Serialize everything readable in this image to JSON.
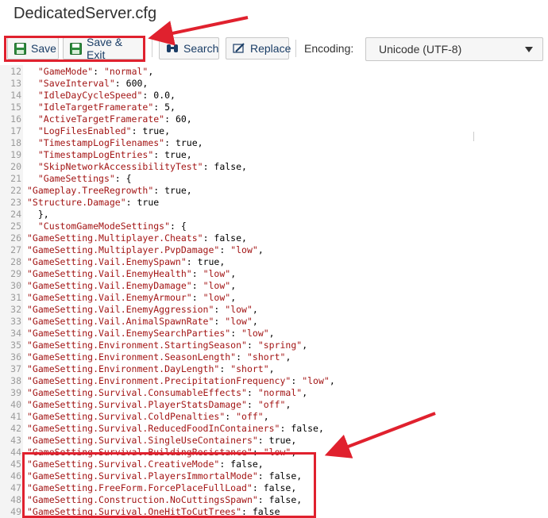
{
  "window": {
    "title": "DedicatedServer.cfg"
  },
  "toolbar": {
    "save_label": "Save",
    "save_exit_label": "Save & Exit",
    "search_label": "Search",
    "replace_label": "Replace",
    "encoding_label": "Encoding:",
    "encoding_value": "Unicode (UTF-8)"
  },
  "colors": {
    "annotation": "#e0212e",
    "string": "#a31515",
    "accent": "#1a3d66"
  },
  "editor": {
    "lines": [
      {
        "n": "12",
        "pre": "  ",
        "key": "\"GameMode\"",
        "post": ": ",
        "val": "\"normal\"",
        "end": ","
      },
      {
        "n": "13",
        "pre": "  ",
        "key": "\"SaveInterval\"",
        "post": ": 600,",
        "val": "",
        "end": ""
      },
      {
        "n": "14",
        "pre": "  ",
        "key": "\"IdleDayCycleSpeed\"",
        "post": ": 0.0,",
        "val": "",
        "end": ""
      },
      {
        "n": "15",
        "pre": "  ",
        "key": "\"IdleTargetFramerate\"",
        "post": ": 5,",
        "val": "",
        "end": ""
      },
      {
        "n": "16",
        "pre": "  ",
        "key": "\"ActiveTargetFramerate\"",
        "post": ": 60,",
        "val": "",
        "end": ""
      },
      {
        "n": "17",
        "pre": "  ",
        "key": "\"LogFilesEnabled\"",
        "post": ": true,",
        "val": "",
        "end": ""
      },
      {
        "n": "18",
        "pre": "  ",
        "key": "\"TimestampLogFilenames\"",
        "post": ": true,",
        "val": "",
        "end": ""
      },
      {
        "n": "19",
        "pre": "  ",
        "key": "\"TimestampLogEntries\"",
        "post": ": true,",
        "val": "",
        "end": ""
      },
      {
        "n": "20",
        "pre": "  ",
        "key": "\"SkipNetworkAccessibilityTest\"",
        "post": ": false,",
        "val": "",
        "end": ""
      },
      {
        "n": "21",
        "pre": "  ",
        "key": "\"GameSettings\"",
        "post": ": {",
        "val": "",
        "end": ""
      },
      {
        "n": "22",
        "pre": "",
        "key": "\"Gameplay.TreeRegrowth\"",
        "post": ": true,",
        "val": "",
        "end": ""
      },
      {
        "n": "23",
        "pre": "",
        "key": "\"Structure.Damage\"",
        "post": ": true",
        "val": "",
        "end": ""
      },
      {
        "n": "24",
        "pre": "  },",
        "key": "",
        "post": "",
        "val": "",
        "end": ""
      },
      {
        "n": "25",
        "pre": "  ",
        "key": "\"CustomGameModeSettings\"",
        "post": ": {",
        "val": "",
        "end": ""
      },
      {
        "n": "26",
        "pre": "",
        "key": "\"GameSetting.Multiplayer.Cheats\"",
        "post": ": false,",
        "val": "",
        "end": ""
      },
      {
        "n": "27",
        "pre": "",
        "key": "\"GameSetting.Multiplayer.PvpDamage\"",
        "post": ": ",
        "val": "\"low\"",
        "end": ","
      },
      {
        "n": "28",
        "pre": "",
        "key": "\"GameSetting.Vail.EnemySpawn\"",
        "post": ": true,",
        "val": "",
        "end": ""
      },
      {
        "n": "29",
        "pre": "",
        "key": "\"GameSetting.Vail.EnemyHealth\"",
        "post": ": ",
        "val": "\"low\"",
        "end": ","
      },
      {
        "n": "30",
        "pre": "",
        "key": "\"GameSetting.Vail.EnemyDamage\"",
        "post": ": ",
        "val": "\"low\"",
        "end": ","
      },
      {
        "n": "31",
        "pre": "",
        "key": "\"GameSetting.Vail.EnemyArmour\"",
        "post": ": ",
        "val": "\"low\"",
        "end": ","
      },
      {
        "n": "32",
        "pre": "",
        "key": "\"GameSetting.Vail.EnemyAggression\"",
        "post": ": ",
        "val": "\"low\"",
        "end": ","
      },
      {
        "n": "33",
        "pre": "",
        "key": "\"GameSetting.Vail.AnimalSpawnRate\"",
        "post": ": ",
        "val": "\"low\"",
        "end": ","
      },
      {
        "n": "34",
        "pre": "",
        "key": "\"GameSetting.Vail.EnemySearchParties\"",
        "post": ": ",
        "val": "\"low\"",
        "end": ","
      },
      {
        "n": "35",
        "pre": "",
        "key": "\"GameSetting.Environment.StartingSeason\"",
        "post": ": ",
        "val": "\"spring\"",
        "end": ","
      },
      {
        "n": "36",
        "pre": "",
        "key": "\"GameSetting.Environment.SeasonLength\"",
        "post": ": ",
        "val": "\"short\"",
        "end": ","
      },
      {
        "n": "37",
        "pre": "",
        "key": "\"GameSetting.Environment.DayLength\"",
        "post": ": ",
        "val": "\"short\"",
        "end": ","
      },
      {
        "n": "38",
        "pre": "",
        "key": "\"GameSetting.Environment.PrecipitationFrequency\"",
        "post": ": ",
        "val": "\"low\"",
        "end": ","
      },
      {
        "n": "39",
        "pre": "",
        "key": "\"GameSetting.Survival.ConsumableEffects\"",
        "post": ": ",
        "val": "\"normal\"",
        "end": ","
      },
      {
        "n": "40",
        "pre": "",
        "key": "\"GameSetting.Survival.PlayerStatsDamage\"",
        "post": ": ",
        "val": "\"off\"",
        "end": ","
      },
      {
        "n": "41",
        "pre": "",
        "key": "\"GameSetting.Survival.ColdPenalties\"",
        "post": ": ",
        "val": "\"off\"",
        "end": ","
      },
      {
        "n": "42",
        "pre": "",
        "key": "\"GameSetting.Survival.ReducedFoodInContainers\"",
        "post": ": false,",
        "val": "",
        "end": ""
      },
      {
        "n": "43",
        "pre": "",
        "key": "\"GameSetting.Survival.SingleUseContainers\"",
        "post": ": true,",
        "val": "",
        "end": ""
      },
      {
        "n": "44",
        "pre": "",
        "key": "\"GameSetting.Survival.BuildingResistance\"",
        "post": ": ",
        "val": "\"low\"",
        "end": ","
      },
      {
        "n": "45",
        "pre": "",
        "key": "\"GameSetting.Survival.CreativeMode\"",
        "post": ": false,",
        "val": "",
        "end": ""
      },
      {
        "n": "46",
        "pre": "",
        "key": "\"GameSetting.Survival.PlayersImmortalMode\"",
        "post": ": false,",
        "val": "",
        "end": ""
      },
      {
        "n": "47",
        "pre": "",
        "key": "\"GameSetting.FreeForm.ForcePlaceFullLoad\"",
        "post": ": false,",
        "val": "",
        "end": ""
      },
      {
        "n": "48",
        "pre": "",
        "key": "\"GameSetting.Construction.NoCuttingsSpawn\"",
        "post": ": false,",
        "val": "",
        "end": ""
      },
      {
        "n": "49",
        "pre": "",
        "key": "\"GameSetting.Survival.OneHitToCutTrees\"",
        "post": ": false",
        "val": "",
        "end": ""
      }
    ]
  }
}
